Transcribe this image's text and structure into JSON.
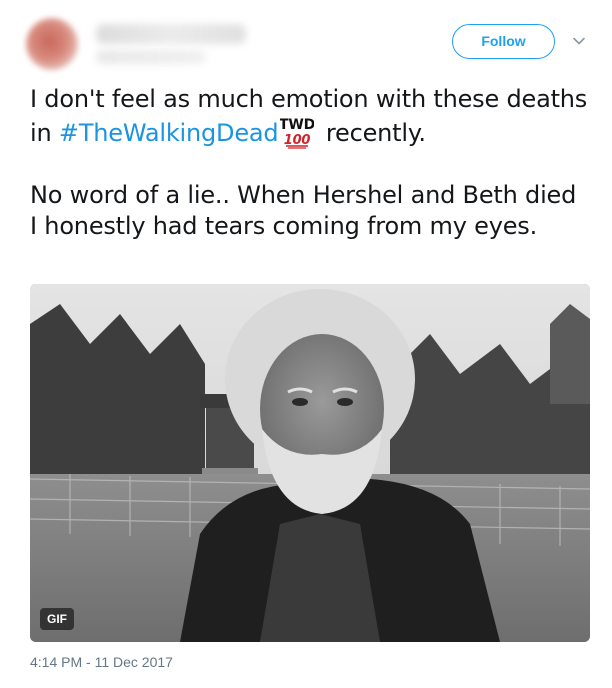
{
  "header": {
    "follow_label": "Follow",
    "accent_color": "#1da1f2"
  },
  "tweet": {
    "line1_before": "I don't feel as much emotion with these deaths in ",
    "hashtag": "#TheWalkingDead",
    "badge_top": "TWD",
    "badge_bottom": "100",
    "line1_after": " recently.",
    "paragraph2": "No word of a lie.. When Hershel and Beth died I honestly had tears coming from my eyes.",
    "hashtag_color": "#1b95e0"
  },
  "media": {
    "gif_label": "GIF"
  },
  "footer": {
    "timestamp": "4:14 PM - 11 Dec 2017"
  },
  "icons": {
    "chevron": "chevron-down-icon",
    "badge": "twd-100-emoji-icon"
  }
}
